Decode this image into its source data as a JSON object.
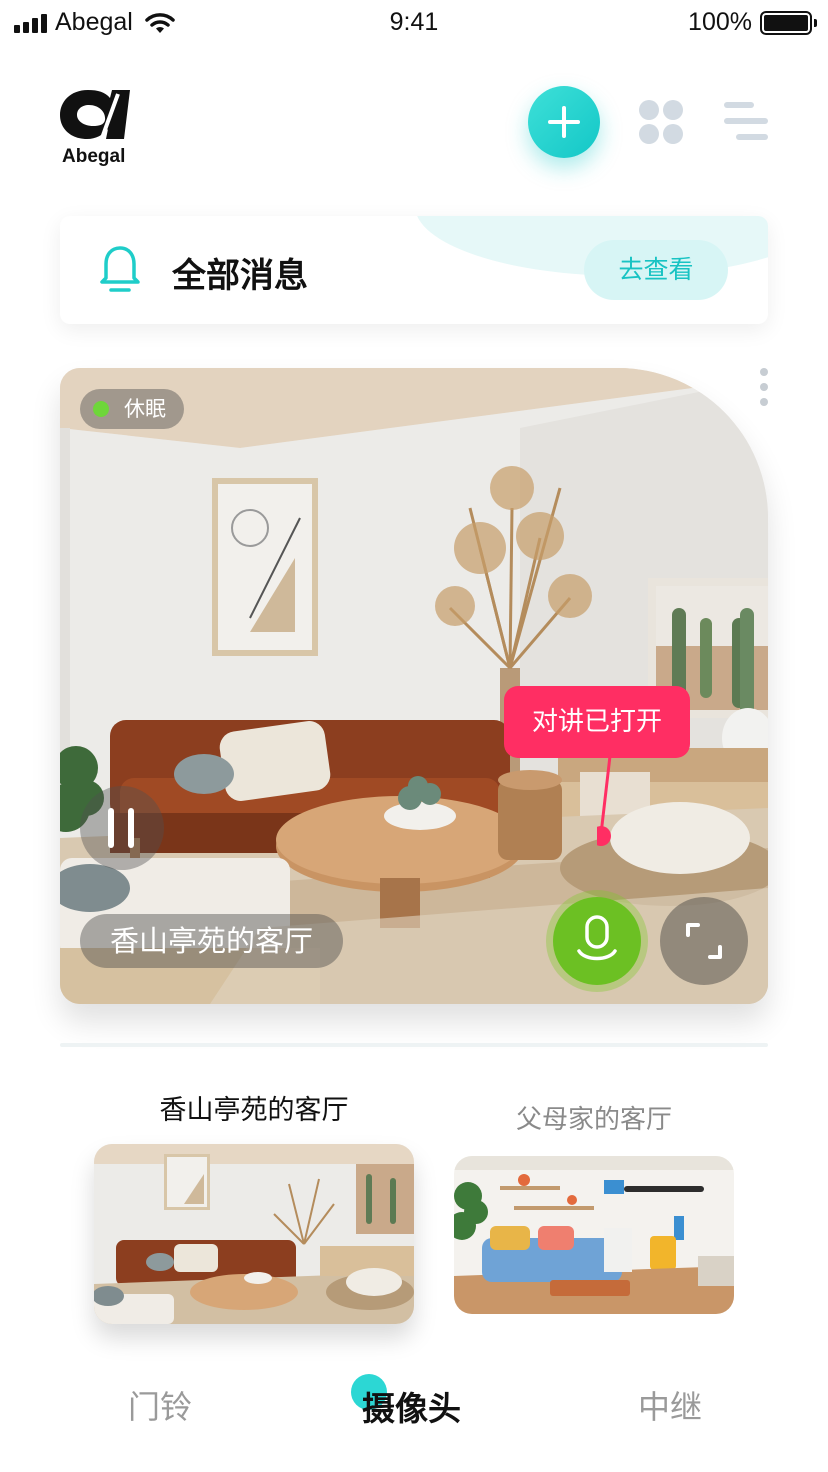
{
  "status_bar": {
    "carrier": "Abegal",
    "time": "9:41",
    "battery": "100%"
  },
  "header": {
    "logo_text": "Abegal"
  },
  "messages": {
    "title": "全部消息",
    "view_label": "去查看"
  },
  "camera": {
    "status": "休眠",
    "name": "香山亭苑的客厅",
    "talk_status": "对讲已打开"
  },
  "devices": [
    {
      "label": "香山亭苑的客厅",
      "selected": true
    },
    {
      "label": "父母家的客厅",
      "selected": false
    }
  ],
  "tabs": [
    {
      "label": "门铃",
      "active": false
    },
    {
      "label": "摄像头",
      "active": true
    },
    {
      "label": "中继",
      "active": false
    }
  ],
  "colors": {
    "accent": "#13c7c7",
    "talk": "#ff2e63",
    "mic": "#6cc023",
    "sleep_dot": "#6ed63a"
  }
}
